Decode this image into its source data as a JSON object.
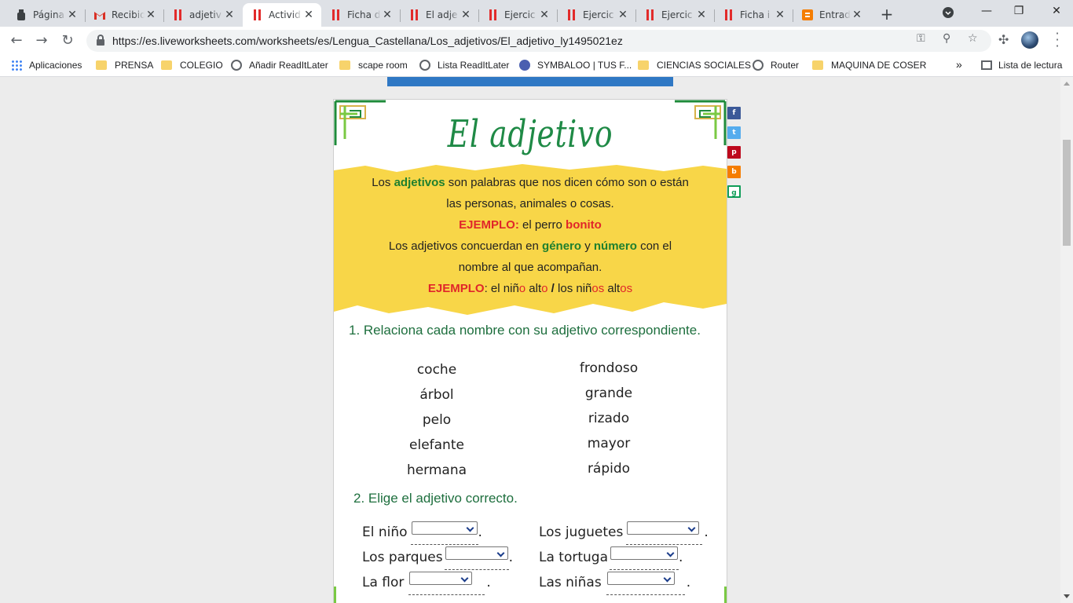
{
  "browser": {
    "tabs": [
      {
        "title": "Página",
        "icon": "page-icon"
      },
      {
        "title": "Recibid",
        "icon": "gmail-icon"
      },
      {
        "title": "adjetiv",
        "icon": "liveworksheets-icon"
      },
      {
        "title": "Activid",
        "icon": "liveworksheets-icon",
        "active": true
      },
      {
        "title": "Ficha d",
        "icon": "liveworksheets-icon"
      },
      {
        "title": "El adje",
        "icon": "liveworksheets-icon"
      },
      {
        "title": "Ejercic",
        "icon": "liveworksheets-icon"
      },
      {
        "title": "Ejercic",
        "icon": "liveworksheets-icon"
      },
      {
        "title": "Ejercic",
        "icon": "liveworksheets-icon"
      },
      {
        "title": "Ficha i",
        "icon": "liveworksheets-icon"
      },
      {
        "title": "Entrad",
        "icon": "blogger-icon"
      }
    ],
    "url": "https://es.liveworksheets.com/worksheets/es/Lengua_Castellana/Los_adjetivos/El_adjetivo_ly1495021ez",
    "bookmarks": [
      {
        "label": "Aplicaciones",
        "icon": "apps-grid-icon"
      },
      {
        "label": "PRENSA",
        "icon": "folder-icon"
      },
      {
        "label": "COLEGIO",
        "icon": "folder-icon"
      },
      {
        "label": "Añadir ReadItLater",
        "icon": "globe-icon"
      },
      {
        "label": "scape room",
        "icon": "folder-icon"
      },
      {
        "label": "Lista ReadItLater",
        "icon": "globe-icon"
      },
      {
        "label": "SYMBALOO | TUS F...",
        "icon": "symbaloo-icon"
      },
      {
        "label": "CIENCIAS SOCIALES",
        "icon": "folder-icon"
      },
      {
        "label": "Router",
        "icon": "globe-icon"
      },
      {
        "label": "MAQUINA DE COSER",
        "icon": "folder-icon"
      }
    ],
    "overflow": "»",
    "reading_list": "Lista de lectura"
  },
  "worksheet": {
    "title": "El adjetivo",
    "intro": {
      "l1a": "Los ",
      "l1b": "adjetivos",
      "l1c": " son palabras que nos dicen cómo son o están",
      "l2": "las personas, animales o cosas.",
      "l3a": "EJEMPLO:",
      "l3b": " el perro ",
      "l3c": "bonito",
      "l4a": "Los adjetivos concuerdan en ",
      "l4b": "género",
      "l4c": " y ",
      "l4d": "número",
      "l4e": " con el",
      "l5": "nombre al que acompañan.",
      "l6a": "EJEMPLO",
      "l6b": ": el niñ",
      "l6c": "o",
      "l6d": " alt",
      "l6e": "o",
      "l6f": " / ",
      "l6g": "los niñ",
      "l6h": "os",
      "l6i": " alt",
      "l6j": "os"
    },
    "q1": "1. Relaciona cada nombre con su adjetivo correspondiente.",
    "nouns": [
      "coche",
      "árbol",
      "pelo",
      "elefante",
      "hermana"
    ],
    "adjectives": [
      "frondoso",
      "grande",
      "rizado",
      "mayor",
      "rápido"
    ],
    "q2": "2. Elige el adjetivo correcto.",
    "sentences_left": [
      {
        "before": "El niño",
        "after": "."
      },
      {
        "before": "Los parques",
        "after": " ."
      },
      {
        "before": "La flor",
        "after": "."
      }
    ],
    "sentences_right": [
      {
        "before": "Los juguetes",
        "after": "."
      },
      {
        "before": "La tortuga",
        "after": "."
      },
      {
        "before": "Las niñas",
        "after": "."
      }
    ],
    "social": [
      "f",
      "t",
      "p",
      "b",
      "g"
    ]
  }
}
